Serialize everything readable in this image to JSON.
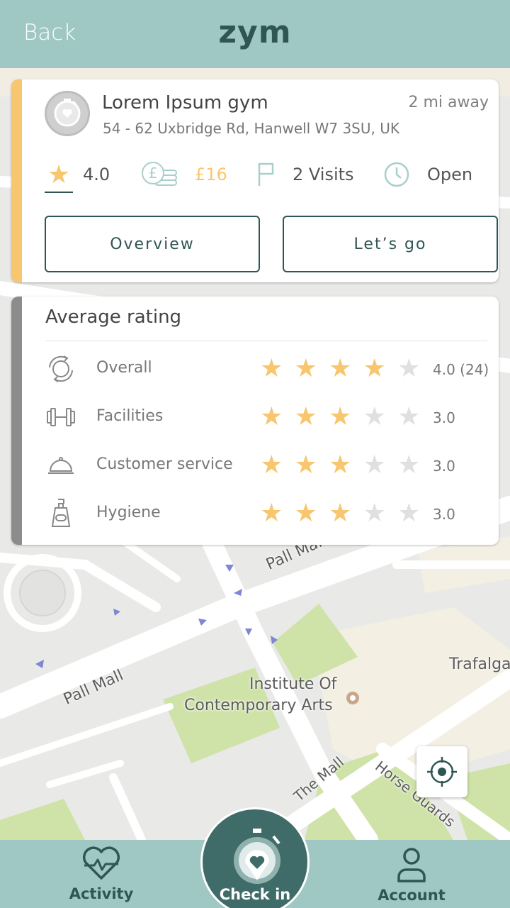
{
  "header": {
    "back_label": "Back",
    "logo_text": "zym"
  },
  "gym": {
    "name": "Lorem Ipsum gym",
    "distance": "2 mi away",
    "address": "54 - 62 Uxbridge Rd, Hanwell W7 3SU, UK",
    "rating": "4.0",
    "price": "£16",
    "visits": "2 Visits",
    "status": "Open",
    "overview_label": "Overview",
    "letsgo_label": "Let’s go"
  },
  "average_rating": {
    "title": "Average rating",
    "rows": [
      {
        "label": "Overall",
        "stars": 4,
        "value": "4.0 (24)",
        "icon": "refresh-cycle-icon"
      },
      {
        "label": "Facilities",
        "stars": 3,
        "value": "3.0",
        "icon": "dumbbell-icon"
      },
      {
        "label": "Customer service",
        "stars": 3,
        "value": "3.0",
        "icon": "service-bell-icon"
      },
      {
        "label": "Hygiene",
        "stars": 3,
        "value": "3.0",
        "icon": "soap-dispenser-icon"
      }
    ],
    "max_stars": 5
  },
  "map": {
    "labels": {
      "pall_mall_1": "Pall Mall",
      "pall_mall_2": "Pall Mall",
      "institute_line1": "Institute Of",
      "institute_line2": "Contemporary Arts",
      "trafalgar": "Trafalga",
      "the_mall": "The Mall",
      "horse_guards": "Horse Guards"
    }
  },
  "nav": {
    "activity_label": "Activity",
    "checkin_label": "Check in",
    "account_label": "Account"
  },
  "colors": {
    "brand_teal": "#9fc7c3",
    "brand_dark": "#2f5554",
    "accent_yellow": "#f8c66e",
    "star_filled": "#f8c66e",
    "star_empty": "#e0e0e0",
    "icon_teal": "#a9cfcb"
  }
}
